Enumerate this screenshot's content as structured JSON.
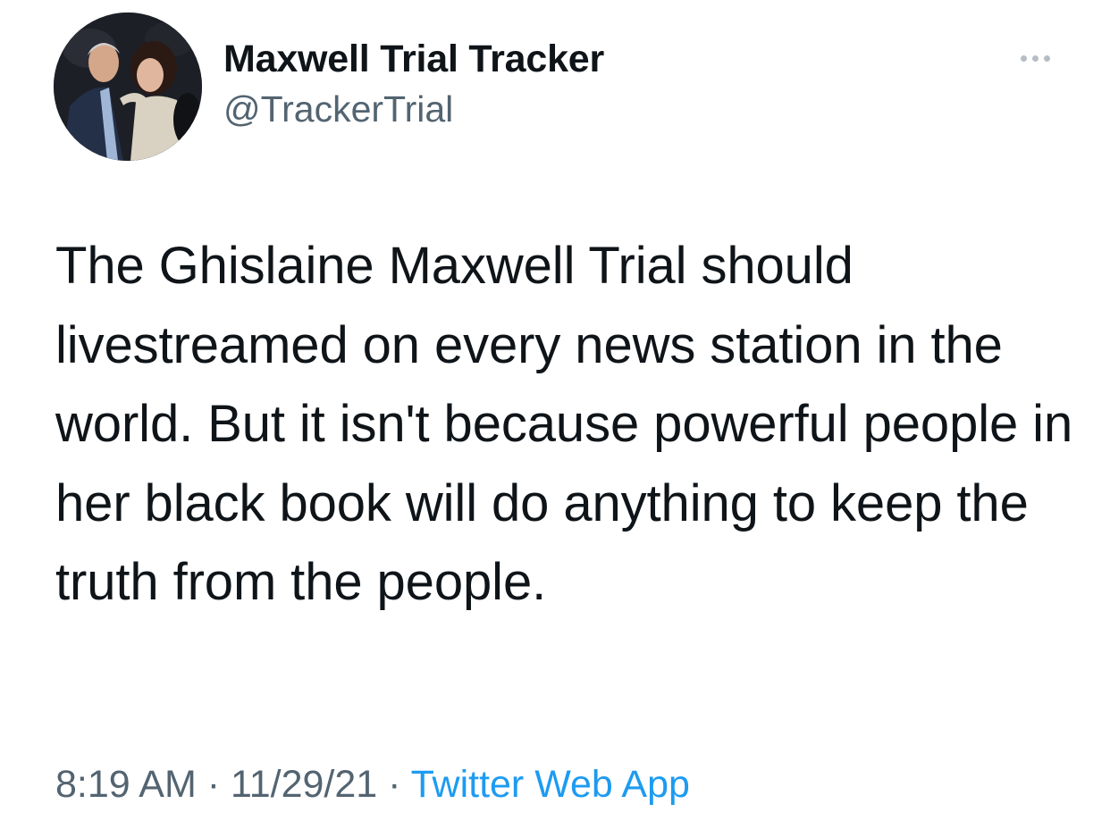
{
  "author": {
    "display_name": "Maxwell Trial Tracker",
    "handle": "@TrackerTrial"
  },
  "tweet": {
    "text": "The Ghislaine Maxwell Trial should livestreamed on every news station in the world. But it isn't because powerful people in her black book will do anything to keep the truth from the people."
  },
  "meta": {
    "time": "8:19 AM",
    "separator_1": " · ",
    "date": "11/29/21",
    "separator_2": " · ",
    "source": "Twitter Web App"
  },
  "icons": {
    "more": "more-horizontal-icon"
  },
  "colors": {
    "text_primary": "#0f1419",
    "text_secondary": "#536471",
    "link_blue": "#1d9bf0",
    "more_dots": "#b6bec5"
  }
}
